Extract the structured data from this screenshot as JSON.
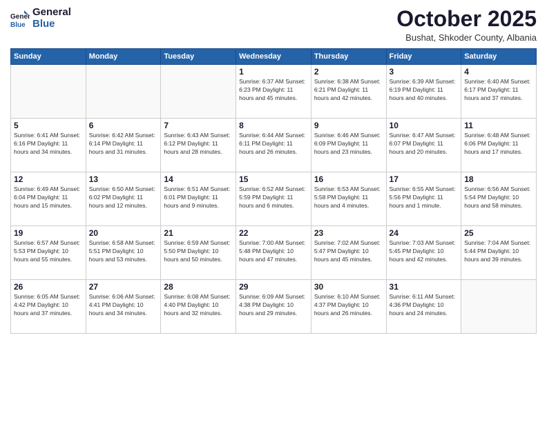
{
  "logo": {
    "line1": "General",
    "line2": "Blue"
  },
  "title": "October 2025",
  "subtitle": "Bushat, Shkoder County, Albania",
  "weekdays": [
    "Sunday",
    "Monday",
    "Tuesday",
    "Wednesday",
    "Thursday",
    "Friday",
    "Saturday"
  ],
  "weeks": [
    [
      {
        "day": "",
        "info": ""
      },
      {
        "day": "",
        "info": ""
      },
      {
        "day": "",
        "info": ""
      },
      {
        "day": "1",
        "info": "Sunrise: 6:37 AM\nSunset: 6:23 PM\nDaylight: 11 hours and 45 minutes."
      },
      {
        "day": "2",
        "info": "Sunrise: 6:38 AM\nSunset: 6:21 PM\nDaylight: 11 hours and 42 minutes."
      },
      {
        "day": "3",
        "info": "Sunrise: 6:39 AM\nSunset: 6:19 PM\nDaylight: 11 hours and 40 minutes."
      },
      {
        "day": "4",
        "info": "Sunrise: 6:40 AM\nSunset: 6:17 PM\nDaylight: 11 hours and 37 minutes."
      }
    ],
    [
      {
        "day": "5",
        "info": "Sunrise: 6:41 AM\nSunset: 6:16 PM\nDaylight: 11 hours and 34 minutes."
      },
      {
        "day": "6",
        "info": "Sunrise: 6:42 AM\nSunset: 6:14 PM\nDaylight: 11 hours and 31 minutes."
      },
      {
        "day": "7",
        "info": "Sunrise: 6:43 AM\nSunset: 6:12 PM\nDaylight: 11 hours and 28 minutes."
      },
      {
        "day": "8",
        "info": "Sunrise: 6:44 AM\nSunset: 6:11 PM\nDaylight: 11 hours and 26 minutes."
      },
      {
        "day": "9",
        "info": "Sunrise: 6:46 AM\nSunset: 6:09 PM\nDaylight: 11 hours and 23 minutes."
      },
      {
        "day": "10",
        "info": "Sunrise: 6:47 AM\nSunset: 6:07 PM\nDaylight: 11 hours and 20 minutes."
      },
      {
        "day": "11",
        "info": "Sunrise: 6:48 AM\nSunset: 6:06 PM\nDaylight: 11 hours and 17 minutes."
      }
    ],
    [
      {
        "day": "12",
        "info": "Sunrise: 6:49 AM\nSunset: 6:04 PM\nDaylight: 11 hours and 15 minutes."
      },
      {
        "day": "13",
        "info": "Sunrise: 6:50 AM\nSunset: 6:02 PM\nDaylight: 11 hours and 12 minutes."
      },
      {
        "day": "14",
        "info": "Sunrise: 6:51 AM\nSunset: 6:01 PM\nDaylight: 11 hours and 9 minutes."
      },
      {
        "day": "15",
        "info": "Sunrise: 6:52 AM\nSunset: 5:59 PM\nDaylight: 11 hours and 6 minutes."
      },
      {
        "day": "16",
        "info": "Sunrise: 6:53 AM\nSunset: 5:58 PM\nDaylight: 11 hours and 4 minutes."
      },
      {
        "day": "17",
        "info": "Sunrise: 6:55 AM\nSunset: 5:56 PM\nDaylight: 11 hours and 1 minute."
      },
      {
        "day": "18",
        "info": "Sunrise: 6:56 AM\nSunset: 5:54 PM\nDaylight: 10 hours and 58 minutes."
      }
    ],
    [
      {
        "day": "19",
        "info": "Sunrise: 6:57 AM\nSunset: 5:53 PM\nDaylight: 10 hours and 55 minutes."
      },
      {
        "day": "20",
        "info": "Sunrise: 6:58 AM\nSunset: 5:51 PM\nDaylight: 10 hours and 53 minutes."
      },
      {
        "day": "21",
        "info": "Sunrise: 6:59 AM\nSunset: 5:50 PM\nDaylight: 10 hours and 50 minutes."
      },
      {
        "day": "22",
        "info": "Sunrise: 7:00 AM\nSunset: 5:48 PM\nDaylight: 10 hours and 47 minutes."
      },
      {
        "day": "23",
        "info": "Sunrise: 7:02 AM\nSunset: 5:47 PM\nDaylight: 10 hours and 45 minutes."
      },
      {
        "day": "24",
        "info": "Sunrise: 7:03 AM\nSunset: 5:45 PM\nDaylight: 10 hours and 42 minutes."
      },
      {
        "day": "25",
        "info": "Sunrise: 7:04 AM\nSunset: 5:44 PM\nDaylight: 10 hours and 39 minutes."
      }
    ],
    [
      {
        "day": "26",
        "info": "Sunrise: 6:05 AM\nSunset: 4:42 PM\nDaylight: 10 hours and 37 minutes."
      },
      {
        "day": "27",
        "info": "Sunrise: 6:06 AM\nSunset: 4:41 PM\nDaylight: 10 hours and 34 minutes."
      },
      {
        "day": "28",
        "info": "Sunrise: 6:08 AM\nSunset: 4:40 PM\nDaylight: 10 hours and 32 minutes."
      },
      {
        "day": "29",
        "info": "Sunrise: 6:09 AM\nSunset: 4:38 PM\nDaylight: 10 hours and 29 minutes."
      },
      {
        "day": "30",
        "info": "Sunrise: 6:10 AM\nSunset: 4:37 PM\nDaylight: 10 hours and 26 minutes."
      },
      {
        "day": "31",
        "info": "Sunrise: 6:11 AM\nSunset: 4:36 PM\nDaylight: 10 hours and 24 minutes."
      },
      {
        "day": "",
        "info": ""
      }
    ]
  ]
}
